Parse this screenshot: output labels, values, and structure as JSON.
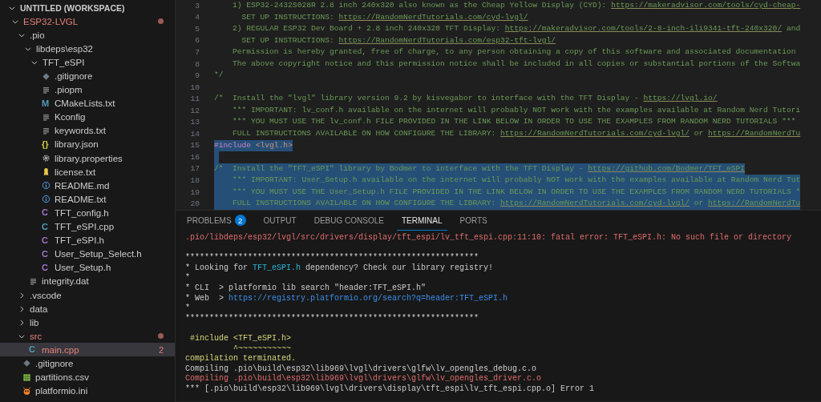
{
  "explorer": {
    "root": {
      "label": "UNTITLED (WORKSPACE)",
      "kind": "workspace",
      "expanded": true,
      "selected": false,
      "problem": false,
      "children": [
        {
          "label": "ESP32-LVGL",
          "kind": "folder",
          "expanded": true,
          "selected": false,
          "problem": true,
          "children": [
            {
              "label": ".pio",
              "kind": "folder",
              "expanded": true,
              "selected": false,
              "problem": false,
              "children": [
                {
                  "label": "libdeps\\esp32",
                  "kind": "folder",
                  "expanded": true,
                  "selected": false,
                  "problem": false,
                  "children": [
                    {
                      "label": "TFT_eSPI",
                      "kind": "folder",
                      "expanded": true,
                      "selected": false,
                      "problem": false,
                      "children": [
                        {
                          "label": ".gitignore",
                          "kind": "git",
                          "selected": false,
                          "problem": false
                        },
                        {
                          "label": ".piopm",
                          "kind": "lines",
                          "selected": false,
                          "problem": false
                        },
                        {
                          "label": "CMakeLists.txt",
                          "kind": "cmake",
                          "glyph": "M",
                          "selected": false,
                          "problem": false
                        },
                        {
                          "label": "Kconfig",
                          "kind": "lines",
                          "selected": false,
                          "problem": false
                        },
                        {
                          "label": "keywords.txt",
                          "kind": "lines",
                          "selected": false,
                          "problem": false
                        },
                        {
                          "label": "library.json",
                          "kind": "json",
                          "glyph": "{}",
                          "selected": false,
                          "problem": false
                        },
                        {
                          "label": "library.properties",
                          "kind": "gear",
                          "selected": false,
                          "problem": false
                        },
                        {
                          "label": "license.txt",
                          "kind": "license",
                          "selected": false,
                          "problem": false
                        },
                        {
                          "label": "README.md",
                          "kind": "info",
                          "selected": false,
                          "problem": false
                        },
                        {
                          "label": "README.txt",
                          "kind": "info",
                          "selected": false,
                          "problem": false
                        },
                        {
                          "label": "TFT_config.h",
                          "kind": "c",
                          "glyph": "C",
                          "selected": false,
                          "problem": false
                        },
                        {
                          "label": "TFT_eSPI.cpp",
                          "kind": "cpp",
                          "glyph": "C",
                          "selected": false,
                          "problem": false
                        },
                        {
                          "label": "TFT_eSPI.h",
                          "kind": "c",
                          "glyph": "C",
                          "selected": false,
                          "problem": false
                        },
                        {
                          "label": "User_Setup_Select.h",
                          "kind": "c",
                          "glyph": "C",
                          "selected": false,
                          "problem": false
                        },
                        {
                          "label": "User_Setup.h",
                          "kind": "c",
                          "glyph": "C",
                          "selected": false,
                          "problem": false
                        }
                      ]
                    }
                  ]
                },
                {
                  "label": "integrity.dat",
                  "kind": "lines",
                  "selected": false,
                  "problem": false
                }
              ]
            },
            {
              "label": ".vscode",
              "kind": "folder",
              "expanded": false,
              "selected": false,
              "problem": false
            },
            {
              "label": "data",
              "kind": "folder",
              "expanded": false,
              "selected": false,
              "problem": false
            },
            {
              "label": "lib",
              "kind": "folder",
              "expanded": false,
              "selected": false,
              "problem": false
            },
            {
              "label": "src",
              "kind": "folder",
              "expanded": true,
              "selected": false,
              "problem": true,
              "children": [
                {
                  "label": "main.cpp",
                  "kind": "cpp",
                  "glyph": "C",
                  "selected": true,
                  "problem": true,
                  "badge": "2"
                }
              ]
            },
            {
              "label": ".gitignore",
              "kind": "git",
              "selected": false,
              "problem": false
            },
            {
              "label": "partitions.csv",
              "kind": "csv",
              "selected": false,
              "problem": false
            },
            {
              "label": "platformio.ini",
              "kind": "platformio",
              "selected": false,
              "problem": false
            }
          ]
        }
      ]
    }
  },
  "editor": {
    "lines": [
      {
        "number": "3",
        "kind": "text",
        "selected": false,
        "segments": [
          {
            "kind": "comment",
            "text": "    1) ESP32-2432S028R 2.8 inch 240x320 also known as the Cheap Yellow Display (CYD): "
          },
          {
            "kind": "link",
            "text": "https://makeradvisor.com/tools/cyd-cheap-"
          }
        ]
      },
      {
        "number": "4",
        "kind": "text",
        "selected": false,
        "segments": [
          {
            "kind": "comment",
            "text": "      SET UP INSTRUCTIONS: "
          },
          {
            "kind": "link",
            "text": "https://RandomNerdTutorials.com/cyd-lvgl/"
          }
        ]
      },
      {
        "number": "5",
        "kind": "text",
        "selected": false,
        "segments": [
          {
            "kind": "comment",
            "text": "    2) REGULAR ESP32 Dev Board + 2.8 inch 240x320 TFT Display: "
          },
          {
            "kind": "link",
            "text": "https://makeradvisor.com/tools/2-8-inch-ili9341-tft-240x320/"
          },
          {
            "kind": "comment",
            "text": " and"
          }
        ]
      },
      {
        "number": "6",
        "kind": "text",
        "selected": false,
        "segments": [
          {
            "kind": "comment",
            "text": "      SET UP INSTRUCTIONS: "
          },
          {
            "kind": "link",
            "text": "https://RandomNerdTutorials.com/esp32-tft-lvgl/"
          }
        ]
      },
      {
        "number": "7",
        "kind": "text",
        "selected": false,
        "segments": [
          {
            "kind": "comment",
            "text": "    Permission is hereby granted, free of charge, to any person obtaining a copy of this software and associated documentation"
          }
        ]
      },
      {
        "number": "8",
        "kind": "text",
        "selected": false,
        "segments": [
          {
            "kind": "comment",
            "text": "    The above copyright notice and this permission notice shall be included in all copies or substantial portions of the Softwa"
          }
        ]
      },
      {
        "number": "9",
        "kind": "text",
        "selected": false,
        "segments": [
          {
            "kind": "comment",
            "text": "*/"
          }
        ]
      },
      {
        "number": "10",
        "kind": "blank",
        "selected": false
      },
      {
        "number": "11",
        "kind": "text",
        "selected": false,
        "segments": [
          {
            "kind": "comment",
            "text": "/*  Install the \"lvgl\" library version 9.2 by kisvegabor to interface with the TFT Display - "
          },
          {
            "kind": "link",
            "text": "https://lvgl.io/"
          }
        ]
      },
      {
        "number": "12",
        "kind": "text",
        "selected": false,
        "segments": [
          {
            "kind": "comment",
            "text": "    *** IMPORTANT: lv_conf.h available on the internet will probably NOT work with the examples available at Random Nerd Tutori"
          }
        ]
      },
      {
        "number": "13",
        "kind": "text",
        "selected": false,
        "segments": [
          {
            "kind": "comment",
            "text": "    *** YOU MUST USE THE lv_conf.h FILE PROVIDED IN THE LINK BELOW IN ORDER TO USE THE EXAMPLES FROM RANDOM NERD TUTORIALS ***"
          }
        ]
      },
      {
        "number": "14",
        "kind": "text",
        "selected": false,
        "segments": [
          {
            "kind": "comment",
            "text": "    FULL INSTRUCTIONS AVAILABLE ON HOW CONFIGURE THE LIBRARY: "
          },
          {
            "kind": "link",
            "text": "https://RandomNerdTutorials.com/cyd-lvgl/"
          },
          {
            "kind": "comment",
            "text": " or "
          },
          {
            "kind": "link",
            "text": "https://RandomNerdTu"
          }
        ]
      },
      {
        "number": "15",
        "kind": "text",
        "selected": true,
        "segments": [
          {
            "kind": "directive",
            "text": "#include "
          },
          {
            "kind": "string",
            "text": "<lvgl.h>"
          }
        ]
      },
      {
        "number": "16",
        "kind": "blank",
        "selected": true
      },
      {
        "number": "17",
        "kind": "text",
        "selected": true,
        "segments": [
          {
            "kind": "comment",
            "text": "/*  Install the \"TFT_eSPI\" library by Bodmer to interface with the TFT Display - "
          },
          {
            "kind": "link",
            "text": "https://github.com/Bodmer/TFT_eSPI"
          }
        ]
      },
      {
        "number": "18",
        "kind": "text",
        "selected": true,
        "segments": [
          {
            "kind": "comment",
            "text": "    *** IMPORTANT: User_Setup.h available on the internet will probably NOT work with the examples available at Random Nerd Tut"
          }
        ]
      },
      {
        "number": "19",
        "kind": "text",
        "selected": true,
        "segments": [
          {
            "kind": "comment",
            "text": "    *** YOU MUST USE THE User_Setup.h FILE PROVIDED IN THE LINK BELOW IN ORDER TO USE THE EXAMPLES FROM RANDOM NERD TUTORIALS *"
          }
        ]
      },
      {
        "number": "20",
        "kind": "text",
        "selected": true,
        "segments": [
          {
            "kind": "comment",
            "text": "    FULL INSTRUCTIONS AVAILABLE ON HOW CONFIGURE THE LIBRARY: "
          },
          {
            "kind": "link",
            "text": "https://RandomNerdTutorials.com/cyd-lvgl/"
          },
          {
            "kind": "comment",
            "text": " or "
          },
          {
            "kind": "link",
            "text": "https://RandomNerdTu"
          }
        ]
      }
    ]
  },
  "panel": {
    "tabs": [
      {
        "label": "PROBLEMS",
        "badge": "2",
        "selected": false
      },
      {
        "label": "OUTPUT",
        "selected": false
      },
      {
        "label": "DEBUG CONSOLE",
        "selected": false
      },
      {
        "label": "TERMINAL",
        "selected": true
      },
      {
        "label": "PORTS",
        "selected": false
      }
    ],
    "terminal": {
      "lines": [
        {
          "kind": "text",
          "segments": [
            {
              "kind": "error",
              "text": ".pio/libdeps/esp32/lvgl/src/drivers/display/tft_espi/lv_tft_espi.cpp:11:10: fatal error: TFT_eSPI.h: No such file or directory"
            }
          ]
        },
        {
          "kind": "blank"
        },
        {
          "kind": "text",
          "segments": [
            {
              "kind": "plain",
              "text": "*************************************************************"
            }
          ]
        },
        {
          "kind": "text",
          "segments": [
            {
              "kind": "plain",
              "text": "* Looking for "
            },
            {
              "kind": "highlight",
              "text": "TFT_eSPI.h"
            },
            {
              "kind": "plain",
              "text": " dependency? Check our library registry!"
            }
          ]
        },
        {
          "kind": "text",
          "segments": [
            {
              "kind": "plain",
              "text": "*"
            }
          ]
        },
        {
          "kind": "text",
          "segments": [
            {
              "kind": "plain",
              "text": "* CLI  > platformio lib search \"header:TFT_eSPI.h\""
            }
          ]
        },
        {
          "kind": "text",
          "segments": [
            {
              "kind": "plain",
              "text": "* Web  > "
            },
            {
              "kind": "link",
              "text": "https://registry.platformio.org/search?q=header:TFT_eSPI.h"
            }
          ]
        },
        {
          "kind": "text",
          "segments": [
            {
              "kind": "plain",
              "text": "*"
            }
          ]
        },
        {
          "kind": "text",
          "segments": [
            {
              "kind": "plain",
              "text": "*************************************************************"
            }
          ]
        },
        {
          "kind": "blank"
        },
        {
          "kind": "text",
          "segments": [
            {
              "kind": "warning",
              "text": " #include <TFT_eSPI.h>"
            }
          ]
        },
        {
          "kind": "text",
          "segments": [
            {
              "kind": "warning",
              "text": "          ^~~~~~~~~~~~"
            }
          ]
        },
        {
          "kind": "text",
          "segments": [
            {
              "kind": "warning",
              "text": "compilation terminated."
            }
          ]
        },
        {
          "kind": "text",
          "segments": [
            {
              "kind": "plain",
              "text": "Compiling .pio\\build\\esp32\\lib969\\lvgl\\drivers\\glfw\\lv_opengles_debug.c.o"
            }
          ]
        },
        {
          "kind": "text",
          "segments": [
            {
              "kind": "error",
              "text": "Compiling .pio\\build\\esp32\\lib969\\lvgl\\drivers\\glfw\\lv_opengles_driver.c.o"
            }
          ]
        },
        {
          "kind": "text",
          "segments": [
            {
              "kind": "plain",
              "text": "*** [.pio\\build\\esp32\\lib969\\lvgl\\drivers\\display\\tft_espi\\lv_tft_espi.cpp.o] Error 1"
            }
          ]
        }
      ]
    }
  }
}
